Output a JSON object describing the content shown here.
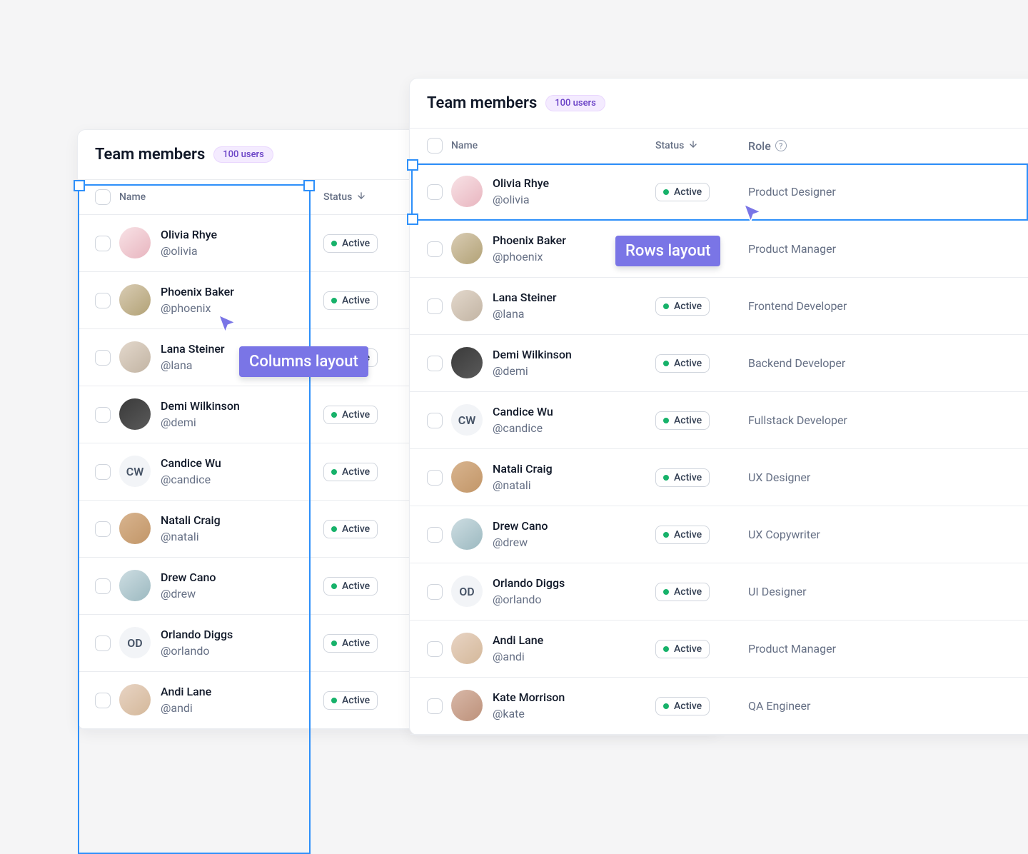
{
  "title": "Team members",
  "count_badge": "100 users",
  "columns": {
    "name": "Name",
    "status": "Status",
    "role": "Role"
  },
  "status_label": "Active",
  "annotations": {
    "columns": "Columns layout",
    "rows": "Rows layout"
  },
  "members": [
    {
      "name": "Olivia Rhye",
      "handle": "@olivia",
      "role": "Product Designer",
      "initials": "",
      "av": "av-bg1"
    },
    {
      "name": "Phoenix Baker",
      "handle": "@phoenix",
      "role": "Product Manager",
      "initials": "",
      "av": "av-bg2"
    },
    {
      "name": "Lana Steiner",
      "handle": "@lana",
      "role": "Frontend Developer",
      "initials": "",
      "av": "av-bg3"
    },
    {
      "name": "Demi Wilkinson",
      "handle": "@demi",
      "role": "Backend Developer",
      "initials": "",
      "av": "av-bg4"
    },
    {
      "name": "Candice Wu",
      "handle": "@candice",
      "role": "Fullstack Developer",
      "initials": "CW",
      "av": "av-bg5"
    },
    {
      "name": "Natali Craig",
      "handle": "@natali",
      "role": "UX Designer",
      "initials": "",
      "av": "av-bg6"
    },
    {
      "name": "Drew Cano",
      "handle": "@drew",
      "role": "UX Copywriter",
      "initials": "",
      "av": "av-bg7"
    },
    {
      "name": "Orlando Diggs",
      "handle": "@orlando",
      "role": "UI Designer",
      "initials": "OD",
      "av": "av-bg8"
    },
    {
      "name": "Andi Lane",
      "handle": "@andi",
      "role": "Product Manager",
      "initials": "",
      "av": "av-bg9"
    },
    {
      "name": "Kate Morrison",
      "handle": "@kate",
      "role": "QA Engineer",
      "initials": "",
      "av": "av-bg10"
    }
  ]
}
